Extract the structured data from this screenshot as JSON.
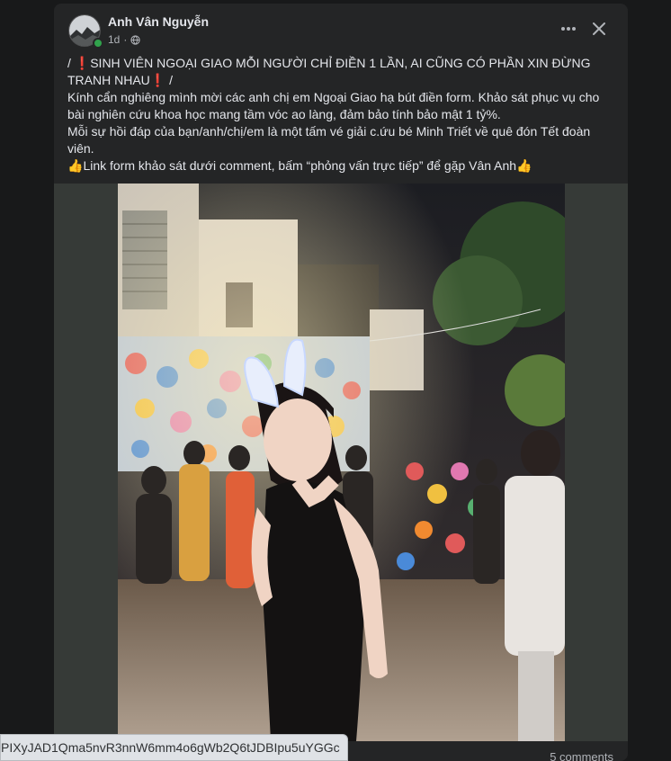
{
  "post": {
    "author": "Anh Vân Nguyễn",
    "time": "1d",
    "privacy_icon": "globe-icon",
    "more_icon": "more-horizontal-icon",
    "close_icon": "close-icon",
    "line1_prefix": "/ ",
    "line1_emoji": "❗",
    "line1_text": "SINH VIÊN NGOẠI GIAO MỖI NGƯỜI CHỈ ĐIỀN 1 LẦN, AI CŨNG CÓ PHẦN XIN ĐỪNG TRANH NHAU",
    "line1_emoji_end": "❗",
    "line1_suffix": " /",
    "para2": "Kính cẩn nghiêng mình mời các anh chị em Ngoại Giao hạ bút điền form. Khảo sát phục vụ cho bài nghiên cứu khoa học mang tầm vóc ao làng, đảm bảo tính bảo mật 1 tỷ%.",
    "para3": "Mỗi sự hồi đáp của bạn/anh/chị/em là một tấm vé giải c.ứu bé Minh Triết về quê đón Tết đoàn viên.",
    "para4_emoji_start": "👍",
    "para4": "Link form khảo sát dưới comment, bấm “phỏng vấn trực tiếp” để gặp Vân Anh",
    "para4_emoji_end": "👍",
    "comments": "5 comments",
    "photo_icon": "night-street-photo"
  },
  "status_url": "PIXyJAD1Qma5nvR3nnW6mm4o6gWb2Q6tJDBIpu5uYGGc",
  "colors": {
    "background": "#18191a",
    "card": "#242526",
    "text": "#e4e6eb",
    "secondary_text": "#b0b3b8",
    "online": "#31a24c"
  }
}
